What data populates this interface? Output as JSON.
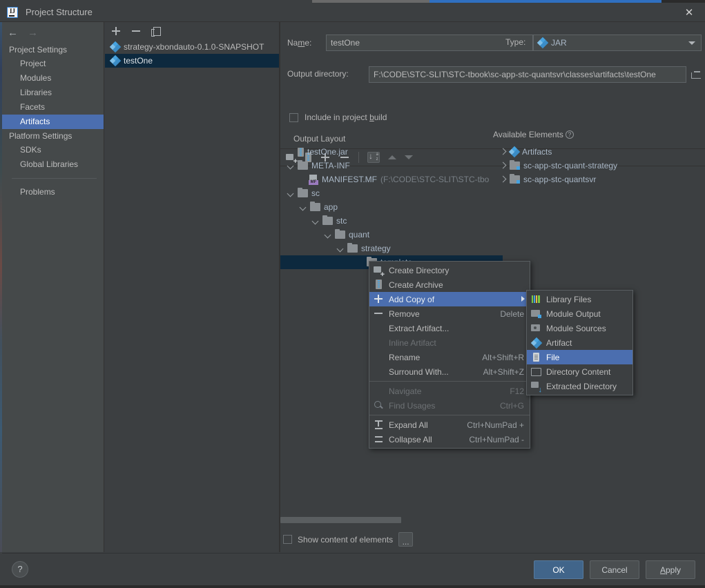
{
  "window": {
    "title": "Project Structure",
    "app_icon": "intellij-logo-icon",
    "close_label": "✕"
  },
  "nav": {
    "back_icon": "arrow-left-icon",
    "forward_icon": "arrow-right-icon"
  },
  "sidebar": {
    "groups": [
      {
        "label": "Project Settings",
        "items": [
          {
            "label": "Project",
            "selected": false
          },
          {
            "label": "Modules",
            "selected": false
          },
          {
            "label": "Libraries",
            "selected": false
          },
          {
            "label": "Facets",
            "selected": false
          },
          {
            "label": "Artifacts",
            "selected": true
          }
        ]
      },
      {
        "label": "Platform Settings",
        "items": [
          {
            "label": "SDKs",
            "selected": false
          },
          {
            "label": "Global Libraries",
            "selected": false
          }
        ]
      }
    ],
    "problems": {
      "label": "Problems"
    },
    "selected_color": "#4b6eaf"
  },
  "artifacts_panel": {
    "toolbar": [
      {
        "name": "add-artifact-button",
        "icon": "plus-icon"
      },
      {
        "name": "remove-artifact-button",
        "icon": "minus-icon"
      },
      {
        "name": "copy-artifact-button",
        "icon": "copy-icon"
      }
    ],
    "items": [
      {
        "label": "strategy-xbondauto-0.1.0-SNAPSHOT",
        "icon": "artifact-diamond-icon",
        "selected": false
      },
      {
        "label": "testOne",
        "icon": "artifact-diamond-icon",
        "selected": true
      }
    ],
    "selected_color": "#0d293e"
  },
  "details": {
    "name_label": "Name:",
    "name_label_mnemonic": "m",
    "name_value": "testOne",
    "type_label": "Type:",
    "type_value": "JAR",
    "type_icon": "artifact-diamond-icon",
    "type_caret": "chevron-down-icon",
    "output_dir_label": "Output directory:",
    "output_dir_value": "F:\\CODE\\STC-SLIT\\STC-tbook\\sc-app-stc-quantsvr\\classes\\artifacts\\testOne",
    "browse_icon": "folder-open-icon",
    "include_in_build_label": "Include in project build",
    "include_in_build_checked": false,
    "output_layout_label": "Output Layout"
  },
  "layout_toolbar": [
    {
      "name": "create-directory-button",
      "icon": "new-folder-icon"
    },
    {
      "name": "create-archive-button",
      "icon": "archive-icon"
    },
    {
      "name": "add-copy-button",
      "icon": "plus-icon"
    },
    {
      "name": "remove-element-button",
      "icon": "minus-icon"
    },
    {
      "name": "sort-button",
      "icon": "sort-az-icon"
    },
    {
      "name": "move-up-button",
      "icon": "triangle-up-icon"
    },
    {
      "name": "move-down-button",
      "icon": "triangle-down-icon"
    }
  ],
  "output_tree": [
    {
      "indent": 0,
      "chevron": "none",
      "icon": "jar-icon",
      "label": "testOne.jar",
      "note": "",
      "selected": false
    },
    {
      "indent": 0,
      "chevron": "down",
      "icon": "folder-icon",
      "label": "META-INF",
      "note": "",
      "selected": false
    },
    {
      "indent": 1,
      "chevron": "none",
      "icon": "manifest-icon",
      "label": "MANIFEST.MF",
      "note": "(F:\\CODE\\STC-SLIT\\STC-tbo",
      "selected": false
    },
    {
      "indent": 0,
      "chevron": "down",
      "icon": "folder-icon",
      "label": "sc",
      "note": "",
      "selected": false
    },
    {
      "indent": 1,
      "chevron": "down",
      "icon": "folder-icon",
      "label": "app",
      "note": "",
      "selected": false
    },
    {
      "indent": 2,
      "chevron": "down",
      "icon": "folder-icon",
      "label": "stc",
      "note": "",
      "selected": false
    },
    {
      "indent": 3,
      "chevron": "down",
      "icon": "folder-icon",
      "label": "quant",
      "note": "",
      "selected": false
    },
    {
      "indent": 4,
      "chevron": "down",
      "icon": "folder-icon",
      "label": "strategy",
      "note": "",
      "selected": false
    },
    {
      "indent": 5,
      "chevron": "none",
      "icon": "folder-icon",
      "label": "template",
      "note": "",
      "selected": true
    }
  ],
  "available_elements": {
    "header": "Available Elements",
    "help_icon": "question-mark-icon",
    "items": [
      {
        "chevron": "right",
        "icon": "artifact-diamond-icon",
        "label": "Artifacts"
      },
      {
        "chevron": "right",
        "icon": "module-output-icon",
        "label": "sc-app-stc-quant-strategy"
      },
      {
        "chevron": "right",
        "icon": "module-output-icon",
        "label": "sc-app-stc-quantsvr"
      }
    ]
  },
  "context_menu": {
    "items": [
      {
        "label": "Create Directory",
        "shortcut": "",
        "icon": "new-folder-icon",
        "state": "normal",
        "submenu": false
      },
      {
        "label": "Create Archive",
        "shortcut": "",
        "icon": "archive-icon",
        "state": "normal",
        "submenu": false
      },
      {
        "label": "Add Copy of",
        "shortcut": "",
        "icon": "plus-icon",
        "state": "highlight",
        "submenu": true
      },
      {
        "label": "Remove",
        "shortcut": "Delete",
        "icon": "minus-icon",
        "state": "normal",
        "submenu": false
      },
      {
        "label": "Extract Artifact...",
        "shortcut": "",
        "icon": "none",
        "state": "normal",
        "submenu": false
      },
      {
        "label": "Inline Artifact",
        "shortcut": "",
        "icon": "none",
        "state": "disabled",
        "submenu": false
      },
      {
        "label": "Rename",
        "shortcut": "Alt+Shift+R",
        "icon": "none",
        "state": "normal",
        "submenu": false
      },
      {
        "label": "Surround With...",
        "shortcut": "Alt+Shift+Z",
        "icon": "none",
        "state": "normal",
        "submenu": false
      },
      {
        "separator": true
      },
      {
        "label": "Navigate",
        "shortcut": "F12",
        "icon": "none",
        "state": "disabled",
        "submenu": false
      },
      {
        "label": "Find Usages",
        "shortcut": "Ctrl+G",
        "icon": "search-icon",
        "state": "disabled",
        "submenu": false
      },
      {
        "separator": true
      },
      {
        "label": "Expand All",
        "shortcut": "Ctrl+NumPad +",
        "icon": "expand-all-icon",
        "state": "normal",
        "submenu": false
      },
      {
        "label": "Collapse All",
        "shortcut": "Ctrl+NumPad -",
        "icon": "collapse-all-icon",
        "state": "normal",
        "submenu": false
      }
    ],
    "highlight_color": "#4b6eaf"
  },
  "submenu": {
    "items": [
      {
        "label": "Library Files",
        "icon": "library-files-icon",
        "state": "normal"
      },
      {
        "label": "Module Output",
        "icon": "module-output-icon",
        "state": "normal"
      },
      {
        "label": "Module Sources",
        "icon": "module-sources-icon",
        "state": "normal"
      },
      {
        "label": "Artifact",
        "icon": "artifact-diamond-icon",
        "state": "normal"
      },
      {
        "label": "File",
        "icon": "file-icon",
        "state": "highlight"
      },
      {
        "label": "Directory Content",
        "icon": "directory-content-icon",
        "state": "normal"
      },
      {
        "label": "Extracted Directory",
        "icon": "extracted-directory-icon",
        "state": "normal"
      }
    ],
    "highlight_color": "#4b6eaf"
  },
  "bottom": {
    "show_content_label": "Show content of elements",
    "show_content_checked": false,
    "ellipsis_label": "..."
  },
  "footer": {
    "help_label": "?",
    "ok_label": "OK",
    "cancel_label": "Cancel",
    "apply_label": "Apply",
    "primary_color": "#41658a"
  }
}
